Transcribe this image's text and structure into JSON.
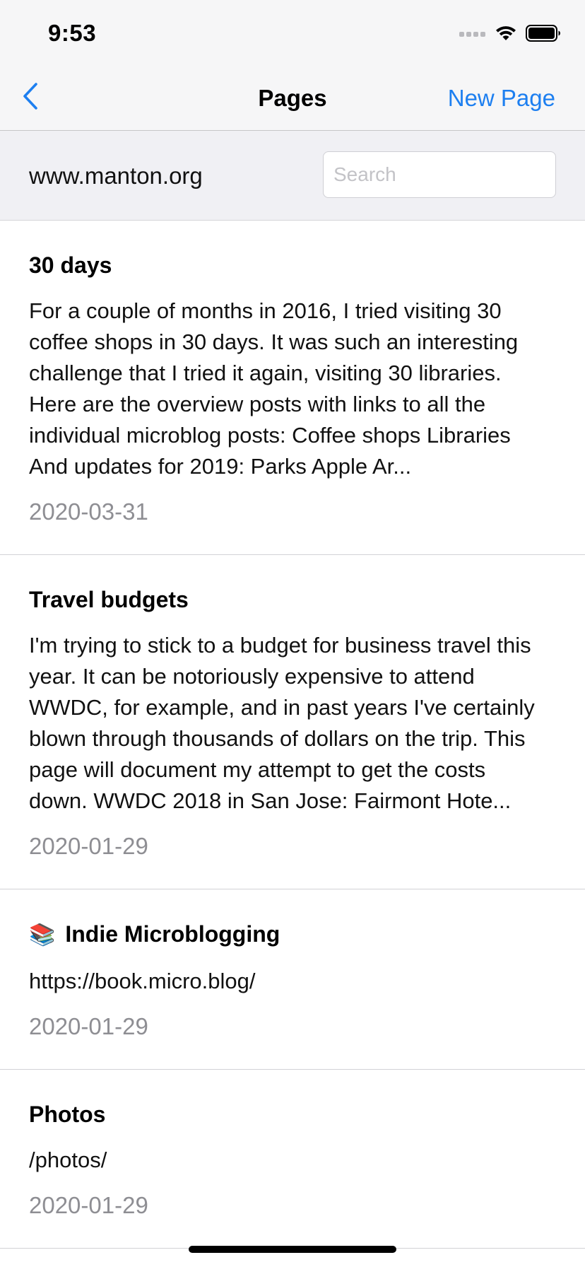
{
  "status_bar": {
    "time": "9:53",
    "icons": [
      "signal-icon",
      "wifi-icon",
      "battery-icon"
    ]
  },
  "nav": {
    "back_icon": "chevron-left-icon",
    "title": "Pages",
    "new_page_label": "New Page"
  },
  "header": {
    "site": "www.manton.org",
    "search_placeholder": "Search",
    "search_value": ""
  },
  "pages": [
    {
      "emoji": "",
      "title": "30 days",
      "body": "For a couple of months in 2016, I tried visiting 30 coffee shops in 30 days. It was such an interesting challenge that I tried it again, visiting 30 libraries. Here are the overview posts with links to all the individual microblog posts: Coffee shops Libraries  And updates for 2019: Parks Apple Ar...",
      "date": "2020-03-31"
    },
    {
      "emoji": "",
      "title": "Travel budgets",
      "body": "I'm trying to stick to a budget for business travel this year. It can be notoriously expensive to attend WWDC, for example, and in past years I've certainly blown through thousands of dollars on the trip. This page will document my attempt to get the costs down. WWDC 2018 in San Jose:  Fairmont Hote...",
      "date": "2020-01-29"
    },
    {
      "emoji": "📚",
      "title": "Indie Microblogging",
      "body": "https://book.micro.blog/",
      "date": "2020-01-29"
    },
    {
      "emoji": "",
      "title": "Photos",
      "body": "/photos/",
      "date": "2020-01-29"
    }
  ],
  "colors": {
    "accent": "#1d7ff0",
    "bar_background": "#f6f6f7",
    "header_background": "#f0f0f4",
    "date_text": "#8e8e93"
  }
}
